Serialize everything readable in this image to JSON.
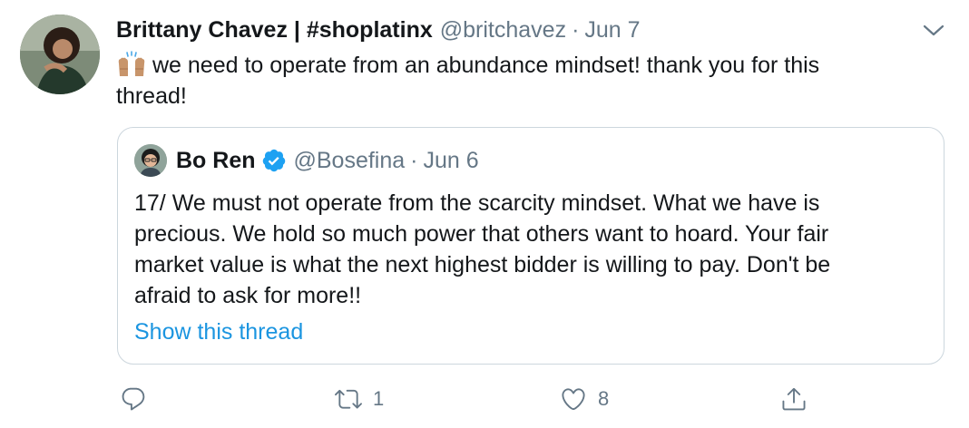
{
  "tweet": {
    "author": {
      "name": "Brittany Chavez | #shoplatinx",
      "handle": "@britchavez",
      "date": "Jun 7"
    },
    "separator": "·",
    "text_line1": "we need to operate from an abundance mindset! thank you for this",
    "text_line2": "thread!",
    "emoji_icon": "raising-hands-icon"
  },
  "quoted_tweet": {
    "author": {
      "name": "Bo Ren",
      "handle": "@Bosefina",
      "date": "Jun 6",
      "verified": true
    },
    "separator": "·",
    "text_lines": [
      "17/ We must not operate from the scarcity mindset. What we have is",
      "precious. We hold so much power that others want to hoard. Your fair",
      "market value is what the next highest bidder is willing to pay. Don't be",
      "afraid to ask for more!!"
    ],
    "show_thread_label": "Show this thread"
  },
  "actions": {
    "reply": {
      "icon": "reply-icon",
      "count": ""
    },
    "retweet": {
      "icon": "retweet-icon",
      "count": "1"
    },
    "like": {
      "icon": "heart-icon",
      "count": "8"
    },
    "share": {
      "icon": "share-icon",
      "count": ""
    }
  },
  "colors": {
    "text": "#14171a",
    "secondary": "#657786",
    "link": "#1b95e0",
    "border": "#ccd6dd",
    "verified": "#1da1f2"
  }
}
